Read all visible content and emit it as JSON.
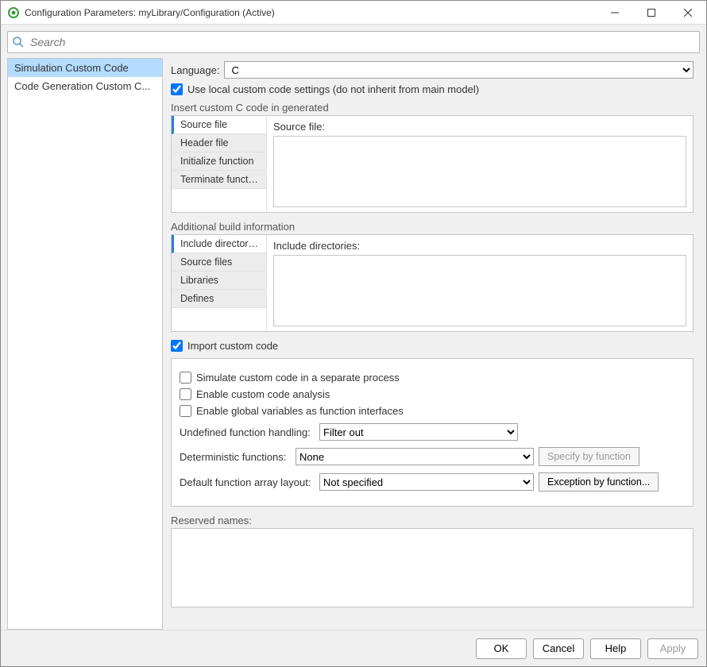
{
  "window": {
    "title": "Configuration Parameters: myLibrary/Configuration (Active)"
  },
  "search": {
    "placeholder": "Search"
  },
  "sidebar": {
    "items": [
      {
        "label": "Simulation Custom Code",
        "selected": true
      },
      {
        "label": "Code Generation Custom C...",
        "selected": false
      }
    ]
  },
  "main": {
    "language_label": "Language:",
    "language_value": "C",
    "use_local_label": "Use local custom code settings (do not inherit from main model)",
    "use_local_checked": true,
    "insert_label": "Insert custom C code in generated",
    "insert_tabs": [
      {
        "label": "Source file",
        "selected": true
      },
      {
        "label": "Header file",
        "selected": false
      },
      {
        "label": "Initialize function",
        "selected": false
      },
      {
        "label": "Terminate function",
        "selected": false
      }
    ],
    "insert_content_label": "Source file:",
    "addbuild_label": "Additional build information",
    "addbuild_tabs": [
      {
        "label": "Include directories",
        "selected": true
      },
      {
        "label": "Source files",
        "selected": false
      },
      {
        "label": "Libraries",
        "selected": false
      },
      {
        "label": "Defines",
        "selected": false
      }
    ],
    "addbuild_content_label": "Include directories:",
    "import_label": "Import custom code",
    "import_checked": true,
    "panel": {
      "simulate_separate_label": "Simulate custom code in a separate process",
      "simulate_separate_checked": false,
      "enable_analysis_label": "Enable custom code analysis",
      "enable_analysis_checked": false,
      "enable_globals_label": "Enable global variables as function interfaces",
      "enable_globals_checked": false,
      "undef_label": "Undefined function handling:",
      "undef_value": "Filter out",
      "determ_label": "Deterministic functions:",
      "determ_value": "None",
      "determ_button": "Specify by function",
      "layout_label": "Default function array layout:",
      "layout_value": "Not specified",
      "layout_button": "Exception by function..."
    },
    "reserved_label": "Reserved names:"
  },
  "footer": {
    "ok": "OK",
    "cancel": "Cancel",
    "help": "Help",
    "apply": "Apply"
  }
}
